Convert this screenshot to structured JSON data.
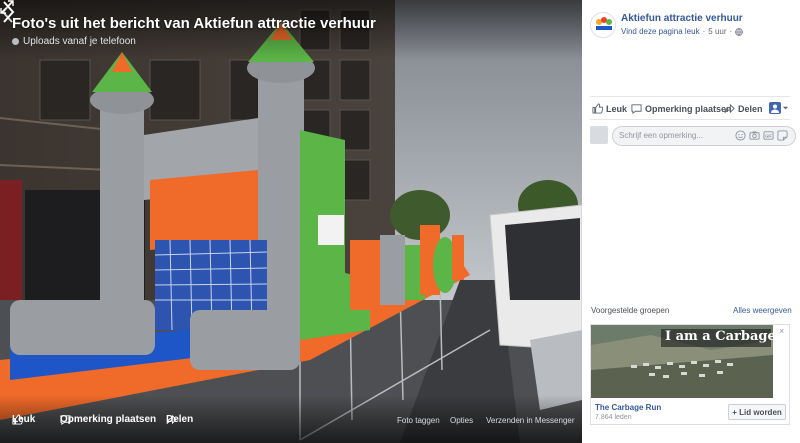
{
  "photo": {
    "title": "Foto's uit het bericht van Aktiefun attractie verhuur",
    "subtitle": "Uploads vanaf je telefoon",
    "footer": {
      "like_label": "Leuk",
      "comment_label": "Opmerking plaatsen",
      "share_label": "Delen",
      "tag_label": "Foto taggen",
      "options_label": "Opties",
      "messenger_label": "Verzenden in Messenger"
    }
  },
  "page": {
    "name": "Aktiefun attractie verhuur",
    "like_prompt": "Vind deze pagina leuk",
    "separator": "·",
    "time": "5 uur",
    "actions": {
      "like": "Leuk",
      "comment": "Opmerking plaatsen",
      "share": "Delen"
    },
    "comment_placeholder": "Schrijf een opmerking..."
  },
  "suggested_groups": {
    "title": "Voorgestelde groepen",
    "see_all": "Alles weergeven",
    "close": "×",
    "group": {
      "banner_text": "I am a Carbage",
      "name": "The Carbage Run",
      "members": "7.864 leden",
      "join_label": "+ Lid worden"
    }
  },
  "colors": {
    "link": "#365899",
    "text": "#4b4f56",
    "muted": "#90949c",
    "inflatable_orange": "#f06a2a",
    "inflatable_green": "#5cb547",
    "inflatable_gray": "#9a9ea3",
    "inflatable_blue": "#1f56c7"
  }
}
